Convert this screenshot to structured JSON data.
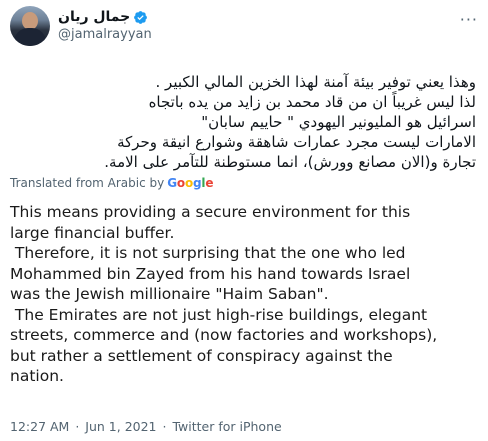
{
  "author": {
    "display_name": "جمال ريان",
    "handle": "@jamalrayyan"
  },
  "more_label": "···",
  "arabic_lines": [
    "وهذا يعني توفير بيئة آمنة لهذا الخزين المالي الكبير .",
    "لذا ليس غريباً ان من قاد محمد بن زايد من يده باتجاه",
    "اسرائيل هو المليونير اليهودي \" حاييم سابان\"",
    "الامارات ليست مجرد عمارات شاهقة وشوارع انيقة وحركة",
    "تجارة و(الان مصانع وورش)، انما مستوطنة للتآمر على الامة."
  ],
  "translation": {
    "label": "Translated from Arabic by",
    "provider": "Google"
  },
  "english_lines": [
    "This means providing a secure environment for this",
    "large financial buffer.",
    " Therefore, it is not surprising that the one who led",
    "Mohammed bin Zayed from his hand towards Israel",
    "was the Jewish millionaire \"Haim Saban\".",
    " The Emirates are not just high-rise buildings, elegant",
    "streets, commerce and (now factories and workshops),",
    "but rather a settlement of conspiracy against the",
    "nation."
  ],
  "meta": {
    "time": "12:27 AM",
    "date": "Jun 1, 2021",
    "source": "Twitter for iPhone",
    "separator": "·"
  },
  "colors": {
    "verified": "#1d9bf0",
    "muted": "#536471",
    "google_g": "#4285F4",
    "google_o1": "#EA4335",
    "google_o2": "#FBBC05",
    "google_l": "#34A853"
  }
}
